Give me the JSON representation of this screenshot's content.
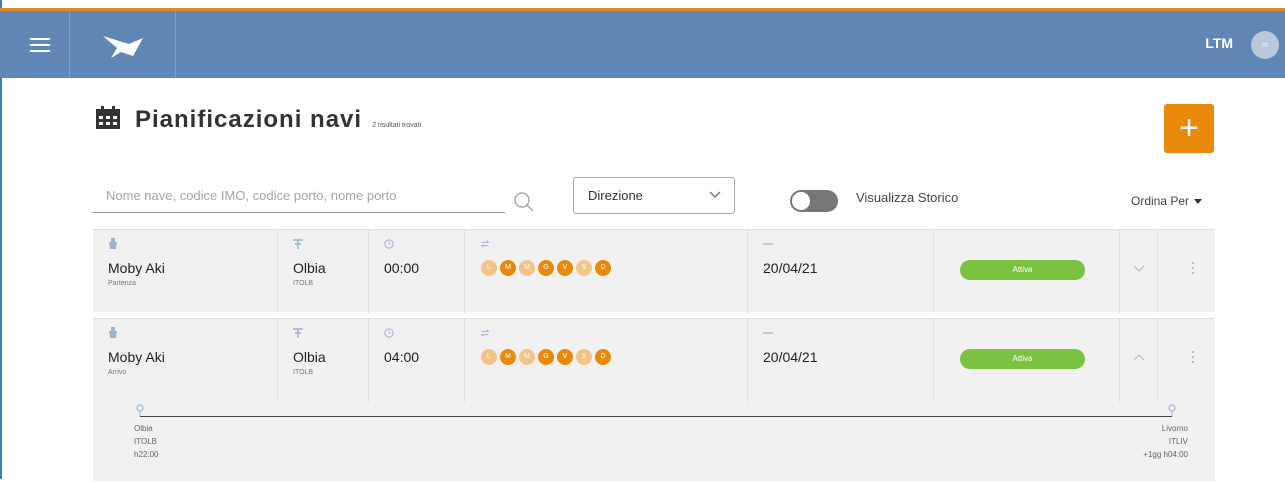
{
  "header": {
    "brand": "LTM",
    "avatar_initials": "m"
  },
  "page": {
    "title": "Pianificazioni navi",
    "count": "2 risultati trovati"
  },
  "filters": {
    "search_placeholder": "Nome nave, codice IMO, codice porto, nome porto",
    "direction_label": "Direzione",
    "history_label": "Visualizza Storico",
    "sort_label": "Ordina Per"
  },
  "rows": [
    {
      "ship": "Moby Aki",
      "direction": "Partenza",
      "port": "Olbia",
      "port_code": "ITOLB",
      "time": "00:00",
      "days": [
        {
          "letter": "L",
          "active": false
        },
        {
          "letter": "M",
          "active": true
        },
        {
          "letter": "M",
          "active": false
        },
        {
          "letter": "G",
          "active": true
        },
        {
          "letter": "V",
          "active": true
        },
        {
          "letter": "S",
          "active": false
        },
        {
          "letter": "D",
          "active": true
        }
      ],
      "date": "20/04/21",
      "status": "Attiva"
    },
    {
      "ship": "Moby Aki",
      "direction": "Arrivo",
      "port": "Olbia",
      "port_code": "ITOLB",
      "time": "04:00",
      "days": [
        {
          "letter": "L",
          "active": false
        },
        {
          "letter": "M",
          "active": true
        },
        {
          "letter": "M",
          "active": false
        },
        {
          "letter": "G",
          "active": true
        },
        {
          "letter": "V",
          "active": true
        },
        {
          "letter": "S",
          "active": false
        },
        {
          "letter": "D",
          "active": true
        }
      ],
      "date": "20/04/21",
      "status": "Attiva",
      "route": {
        "from_name": "Olbia",
        "from_code": "ITOLB",
        "from_time": "h22:00",
        "to_name": "Livorno",
        "to_code": "ITLIV",
        "to_time": "+1gg h04:00"
      }
    }
  ],
  "colors": {
    "appbar": "#5f86b5",
    "accent": "#e8890c",
    "status_active": "#7cc242"
  }
}
